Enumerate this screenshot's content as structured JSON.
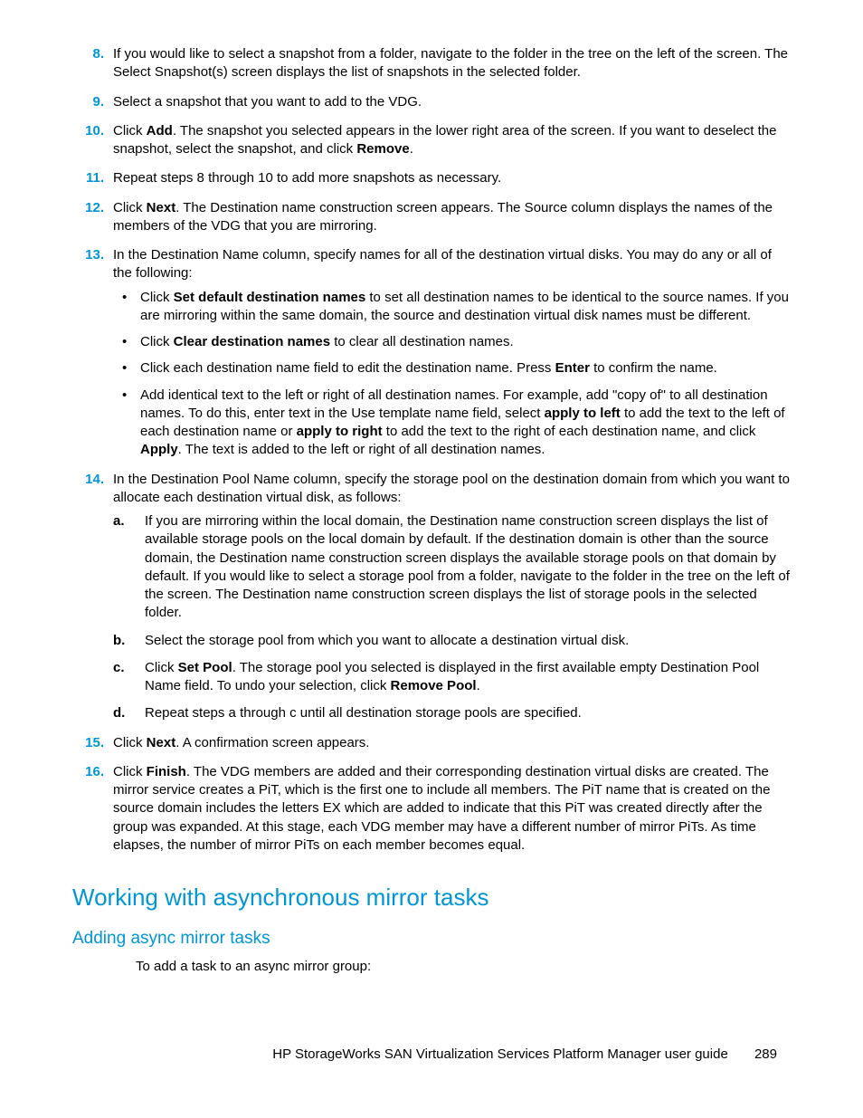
{
  "steps": [
    {
      "n": "8.",
      "text": "If you would like to select a snapshot from a folder, navigate to the folder in the tree on the left of the screen. The Select Snapshot(s) screen displays the list of snapshots in the selected folder."
    },
    {
      "n": "9.",
      "text": "Select a snapshot that you want to add to the VDG."
    },
    {
      "n": "10.",
      "pre": "Click ",
      "bold1": "Add",
      "mid": ". The snapshot you selected appears in the lower right area of the screen. If you want to deselect the snapshot, select the snapshot, and click ",
      "bold2": "Remove",
      "post": "."
    },
    {
      "n": "11.",
      "text": "Repeat steps 8 through 10 to add more snapshots as necessary."
    },
    {
      "n": "12.",
      "pre": "Click ",
      "bold1": "Next",
      "post": ". The Destination name construction screen appears. The Source column displays the names of the members of the VDG that you are mirroring."
    },
    {
      "n": "13.",
      "text": "In the Destination Name column, specify names for all of the destination virtual disks. You may do any or all of the following:"
    },
    {
      "n": "14.",
      "text": "In the Destination Pool Name column, specify the storage pool on the destination domain from which you want to allocate each destination virtual disk, as follows:"
    },
    {
      "n": "15.",
      "pre": "Click ",
      "bold1": "Next",
      "post": ". A confirmation screen appears."
    },
    {
      "n": "16.",
      "pre": "Click ",
      "bold1": "Finish",
      "post": ". The VDG members are added and their corresponding destination virtual disks are created. The mirror service creates a PiT, which is the first one to include all members. The PiT name that is created on the source domain includes the letters EX which are added to indicate that this PiT was created directly after the group was expanded. At this stage, each VDG member may have a different number of mirror PiTs. As time elapses, the number of mirror PiTs on each member becomes equal."
    }
  ],
  "bullets13": {
    "b1": {
      "pre": "Click ",
      "bold": "Set default destination names",
      "post": " to set all destination names to be identical to the source names. If you are mirroring within the same domain, the source and destination virtual disk names must be different."
    },
    "b2": {
      "pre": "Click ",
      "bold": "Clear destination names",
      "post": " to clear all destination names."
    },
    "b3": {
      "pre": "Click each destination name field to edit the destination name. Press ",
      "bold": "Enter",
      "post": " to confirm the name."
    },
    "b4": {
      "pre": "Add identical text to the left or right of all destination names. For example, add \"copy of\" to all destination names. To do this, enter text in the Use template name field, select ",
      "bold1": "apply to left",
      "mid": " to add the text to the left of each destination name or ",
      "bold2": "apply to right",
      "mid2": " to add the text to the right of each destination name, and click ",
      "bold3": "Apply",
      "post": ". The text is added to the left or right of all destination names."
    }
  },
  "letters14": {
    "a": "If you are mirroring within the local domain, the Destination name construction screen displays the list of available storage pools on the local domain by default. If the destination domain is other than the source domain, the Destination name construction screen displays the available storage pools on that domain by default. If you would like to select a storage pool from a folder, navigate to the folder in the tree on the left of the screen. The Destination name construction screen displays the list of storage pools in the selected folder.",
    "b": "Select the storage pool from which you want to allocate a destination virtual disk.",
    "c": {
      "pre": "Click ",
      "bold1": "Set Pool",
      "mid": ". The storage pool you selected is displayed in the first available empty Destination Pool Name field. To undo your selection, click ",
      "bold2": "Remove Pool",
      "post": "."
    },
    "d": "Repeat steps a through c until all destination storage pools are specified."
  },
  "heading": "Working with asynchronous mirror tasks",
  "subheading": "Adding async mirror tasks",
  "intro": "To add a task to an async mirror group:",
  "footer_title": "HP StorageWorks SAN Virtualization Services Platform Manager user guide",
  "page_num": "289",
  "letter_a": "a.",
  "letter_b": "b.",
  "letter_c": "c.",
  "letter_d": "d."
}
